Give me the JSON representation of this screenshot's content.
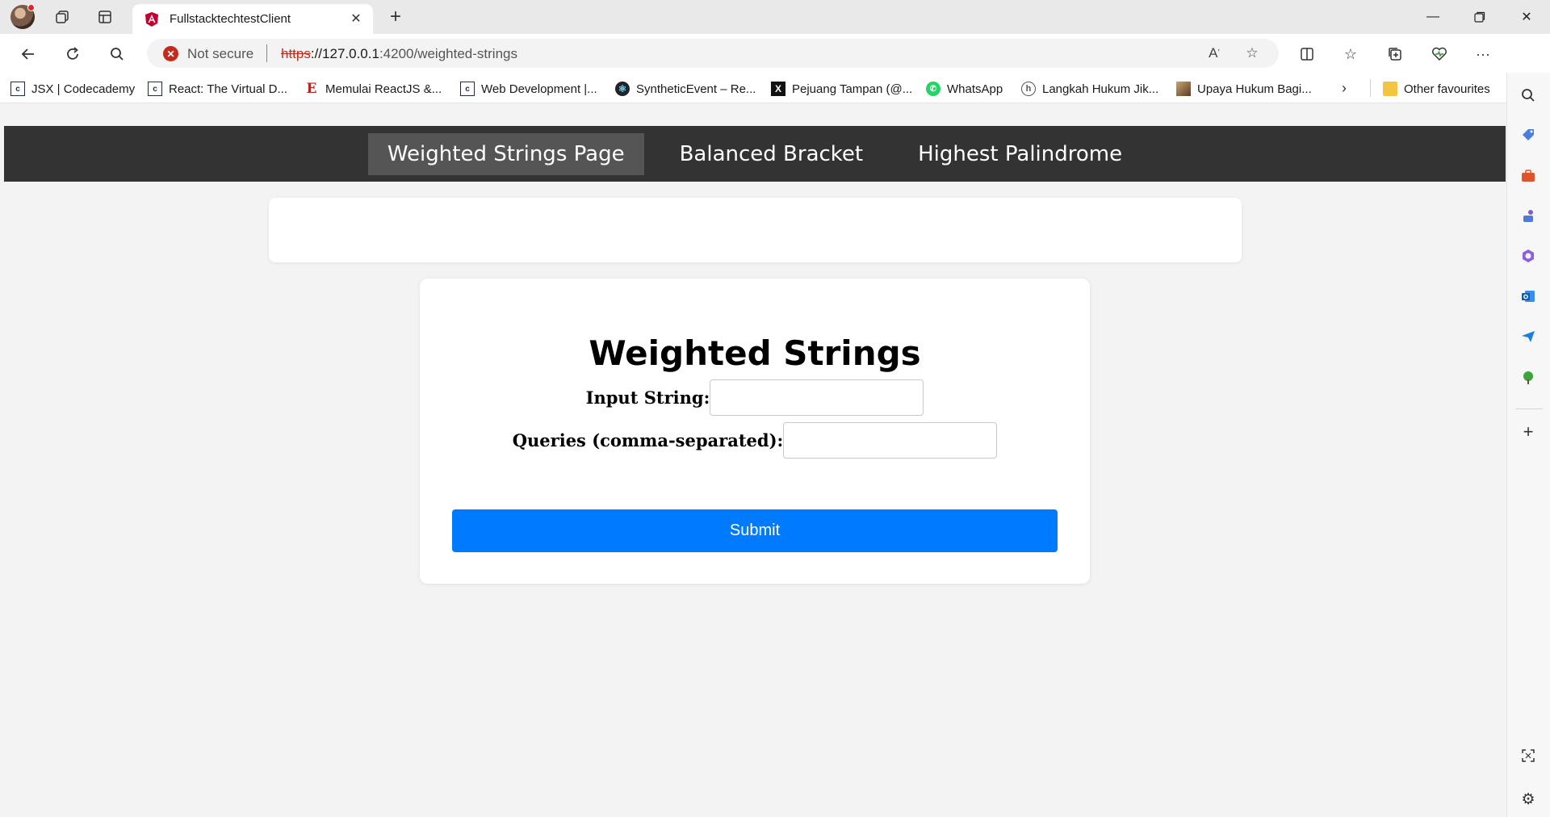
{
  "browser": {
    "tab": {
      "title": "FullstacktechtestClient"
    },
    "address": {
      "security_label": "Not secure",
      "url_scheme": "https",
      "url_host": "://127.0.0.1",
      "url_rest": ":4200/weighted-strings"
    },
    "bookmarks": [
      {
        "label": "JSX | Codecademy",
        "icon": "codecademy-icon"
      },
      {
        "label": "React: The Virtual D...",
        "icon": "codecademy-icon"
      },
      {
        "label": "Memulai ReactJS &...",
        "icon": "e-icon"
      },
      {
        "label": "Web Development |...",
        "icon": "codecademy-icon"
      },
      {
        "label": "SyntheticEvent – Re...",
        "icon": "react-icon"
      },
      {
        "label": "Pejuang Tampan (@...",
        "icon": "x-icon"
      },
      {
        "label": "WhatsApp",
        "icon": "whatsapp-icon"
      },
      {
        "label": "Langkah Hukum Jik...",
        "icon": "h-icon"
      },
      {
        "label": "Upaya Hukum Bagi...",
        "icon": "image-icon"
      }
    ],
    "other_favourites": "Other favourites"
  },
  "app": {
    "nav": [
      {
        "label": "Weighted Strings Page",
        "active": true
      },
      {
        "label": "Balanced Bracket",
        "active": false
      },
      {
        "label": "Highest Palindrome",
        "active": false
      }
    ],
    "form": {
      "title": "Weighted Strings",
      "input_label": "Input String:",
      "input_value": "",
      "queries_label": "Queries (comma-separated):",
      "queries_value": "",
      "submit_label": "Submit"
    }
  },
  "colors": {
    "nav_bg": "#333333",
    "nav_active_bg": "#555555",
    "submit_bg": "#007bff",
    "insecure_red": "#c42b1c"
  }
}
